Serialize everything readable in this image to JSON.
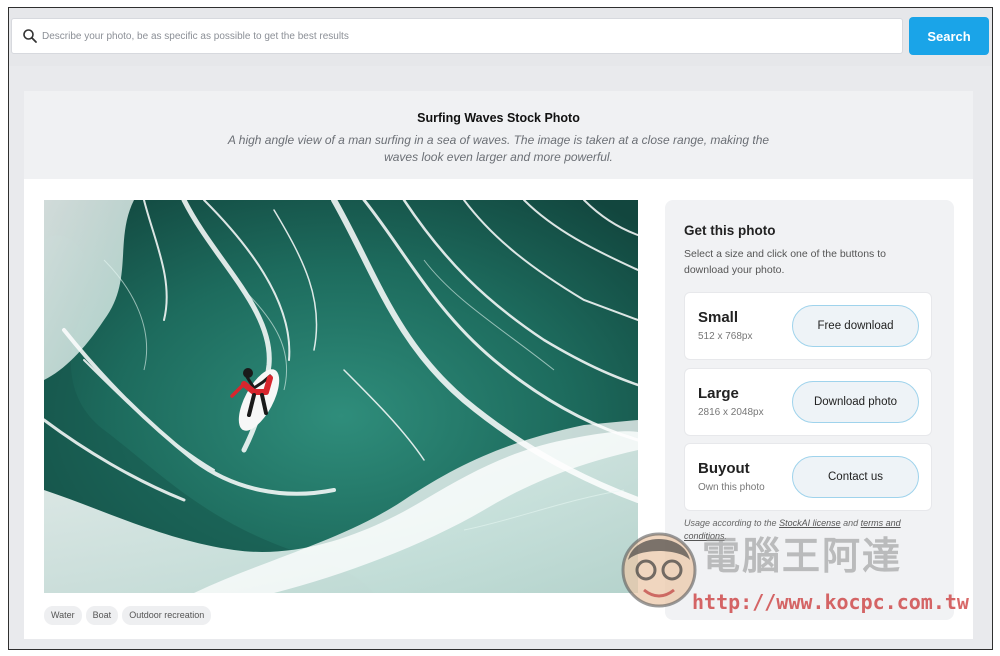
{
  "search": {
    "placeholder": "Describe your photo, be as specific as possible to get the best results",
    "button_label": "Search"
  },
  "photo": {
    "title": "Surfing Waves Stock Photo",
    "description": "A high angle view of a man surfing in a sea of waves. The image is taken at a close range, making the waves look even larger and more powerful.",
    "tags": [
      "Water",
      "Boat",
      "Outdoor recreation"
    ]
  },
  "get_panel": {
    "title": "Get this photo",
    "subtitle": "Select a size and click one of the buttons to download your photo.",
    "options": [
      {
        "name": "Small",
        "size": "512 x 768px",
        "button": "Free download"
      },
      {
        "name": "Large",
        "size": "2816 x 2048px",
        "button": "Download photo"
      },
      {
        "name": "Buyout",
        "size": "Own this photo",
        "button": "Contact us"
      }
    ],
    "license": {
      "prefix": "Usage according to the ",
      "license_link": "StockAI license",
      "middle": " and ",
      "terms_link": "terms and conditions",
      "suffix": "."
    }
  },
  "watermark": {
    "text": "電腦王阿達",
    "url": "http://www.kocpc.com.tw"
  },
  "colors": {
    "accent": "#1aa4e8",
    "ocean": "#1e6a5e",
    "surfer_suit": "#d8262e"
  }
}
